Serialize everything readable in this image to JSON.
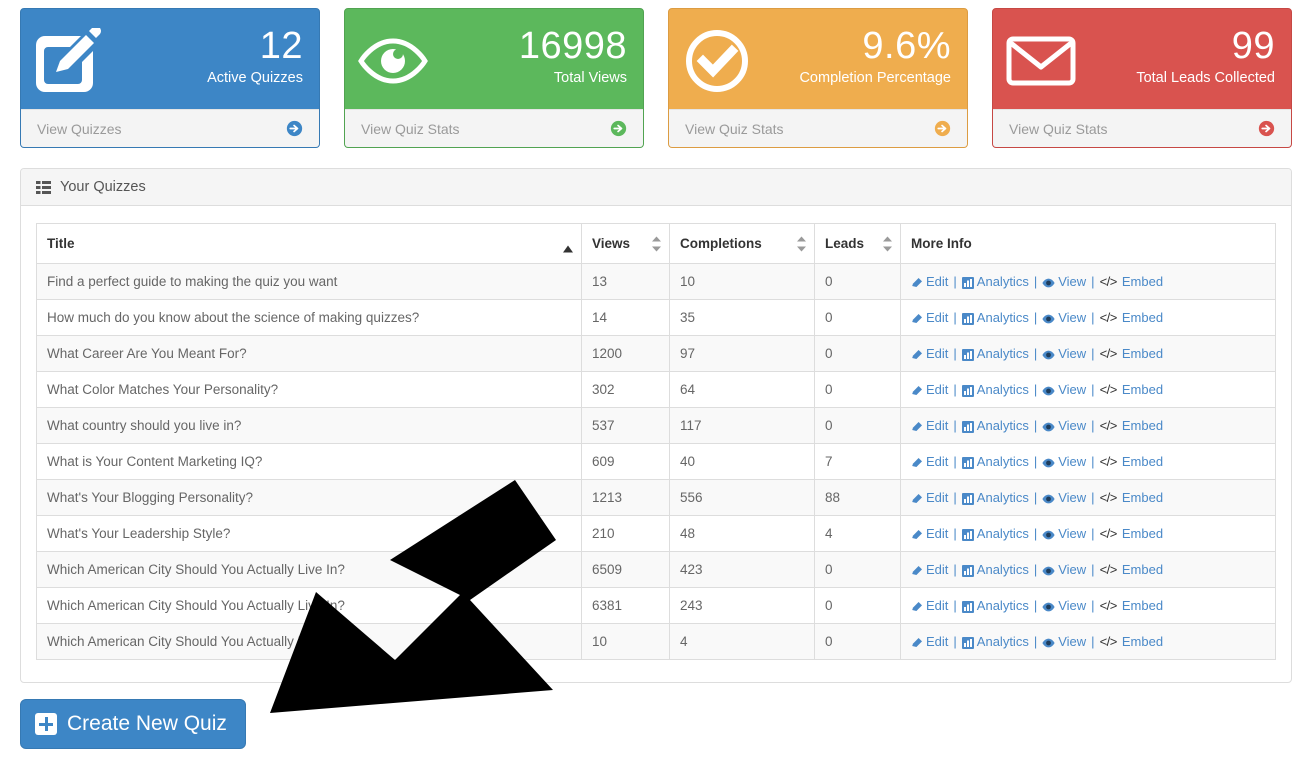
{
  "cards": [
    {
      "icon": "pencil-square-icon",
      "value": "12",
      "label": "Active Quizzes",
      "footer_label": "View Quizzes",
      "color": "#3d86c6"
    },
    {
      "icon": "eye-icon",
      "value": "16998",
      "label": "Total Views",
      "footer_label": "View Quiz Stats",
      "color": "#5cb85c"
    },
    {
      "icon": "check-circle-icon",
      "value": "9.6%",
      "label": "Completion Percentage",
      "footer_label": "View Quiz Stats",
      "color": "#efad4e"
    },
    {
      "icon": "envelope-icon",
      "value": "99",
      "label": "Total Leads Collected",
      "footer_label": "View Quiz Stats",
      "color": "#d9534f"
    }
  ],
  "panel": {
    "icon": "th-list-icon",
    "title": "Your Quizzes"
  },
  "table": {
    "columns": [
      {
        "label": "Title",
        "sort": "asc"
      },
      {
        "label": "Views",
        "sort": "both"
      },
      {
        "label": "Completions",
        "sort": "both"
      },
      {
        "label": "Leads",
        "sort": "both"
      },
      {
        "label": "More Info",
        "sort": "none"
      }
    ],
    "actions": {
      "edit": "Edit",
      "analytics": "Analytics",
      "view": "View",
      "embed": "Embed",
      "separator": "|",
      "embed_glyph": "</>"
    },
    "rows": [
      {
        "title": "Find a perfect guide to making the quiz you want",
        "views": "13",
        "completions": "10",
        "leads": "0"
      },
      {
        "title": "How much do you know about the science of making quizzes?",
        "views": "14",
        "completions": "35",
        "leads": "0"
      },
      {
        "title": "What Career Are You Meant For?",
        "views": "1200",
        "completions": "97",
        "leads": "0"
      },
      {
        "title": "What Color Matches Your Personality?",
        "views": "302",
        "completions": "64",
        "leads": "0"
      },
      {
        "title": "What country should you live in?",
        "views": "537",
        "completions": "117",
        "leads": "0"
      },
      {
        "title": "What is Your Content Marketing IQ?",
        "views": "609",
        "completions": "40",
        "leads": "7"
      },
      {
        "title": "What's Your Blogging Personality?",
        "views": "1213",
        "completions": "556",
        "leads": "88"
      },
      {
        "title": "What's Your Leadership Style?",
        "views": "210",
        "completions": "48",
        "leads": "4"
      },
      {
        "title": "Which American City Should You Actually Live In?",
        "views": "6509",
        "completions": "423",
        "leads": "0"
      },
      {
        "title": "Which American City Should You Actually Live In?",
        "views": "6381",
        "completions": "243",
        "leads": "0"
      },
      {
        "title": "Which American City Should You Actually Live In?",
        "views": "10",
        "completions": "4",
        "leads": "0"
      }
    ]
  },
  "create_button": {
    "label": "Create New Quiz",
    "icon": "plus-square-icon"
  }
}
